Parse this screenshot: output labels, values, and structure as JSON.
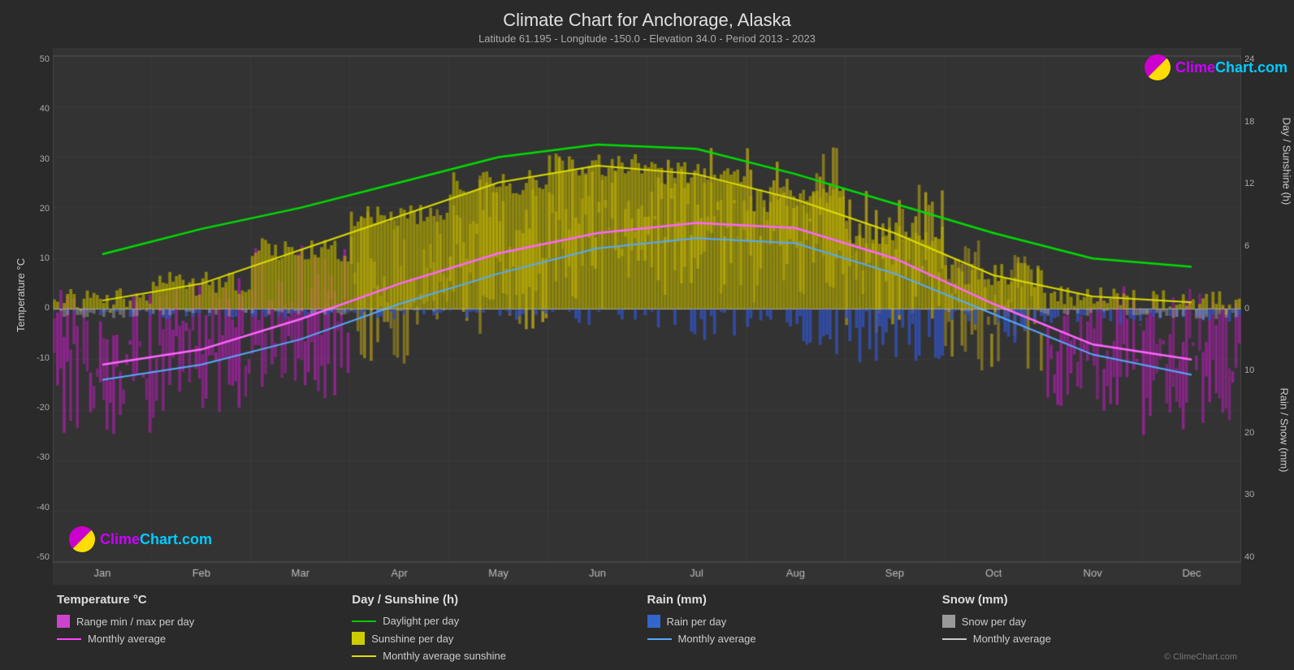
{
  "title": "Climate Chart for Anchorage, Alaska",
  "subtitle": "Latitude 61.195 - Longitude -150.0 - Elevation 34.0 - Period 2013 - 2023",
  "logo_text": "ClimeChart.com",
  "copyright": "© ClimeChart.com",
  "y_axis_left": {
    "label": "Temperature °C",
    "values": [
      "50",
      "40",
      "30",
      "20",
      "10",
      "0",
      "-10",
      "-20",
      "-30",
      "-40",
      "-50"
    ]
  },
  "y_axis_right_sunshine": {
    "label": "Day / Sunshine (h)",
    "values": [
      "24",
      "18",
      "12",
      "6",
      "0"
    ]
  },
  "y_axis_right_rain": {
    "label": "Rain / Snow (mm)",
    "values": [
      "0",
      "10",
      "20",
      "30",
      "40"
    ]
  },
  "x_axis": {
    "months": [
      "Jan",
      "Feb",
      "Mar",
      "Apr",
      "May",
      "Jun",
      "Jul",
      "Aug",
      "Sep",
      "Oct",
      "Nov",
      "Dec"
    ]
  },
  "legend": {
    "temperature": {
      "title": "Temperature °C",
      "items": [
        {
          "label": "Range min / max per day",
          "type": "bar",
          "color": "#cc00cc"
        },
        {
          "label": "Monthly average",
          "type": "line",
          "color": "#ff44ff"
        }
      ]
    },
    "sunshine": {
      "title": "Day / Sunshine (h)",
      "items": [
        {
          "label": "Daylight per day",
          "type": "line",
          "color": "#00dd00"
        },
        {
          "label": "Sunshine per day",
          "type": "bar",
          "color": "#cccc00"
        },
        {
          "label": "Monthly average sunshine",
          "type": "line",
          "color": "#dddd00"
        }
      ]
    },
    "rain": {
      "title": "Rain (mm)",
      "items": [
        {
          "label": "Rain per day",
          "type": "bar",
          "color": "#4488ff"
        },
        {
          "label": "Monthly average",
          "type": "line",
          "color": "#44aaff"
        }
      ]
    },
    "snow": {
      "title": "Snow (mm)",
      "items": [
        {
          "label": "Snow per day",
          "type": "bar",
          "color": "#aaaaaa"
        },
        {
          "label": "Monthly average",
          "type": "line",
          "color": "#cccccc"
        }
      ]
    }
  }
}
